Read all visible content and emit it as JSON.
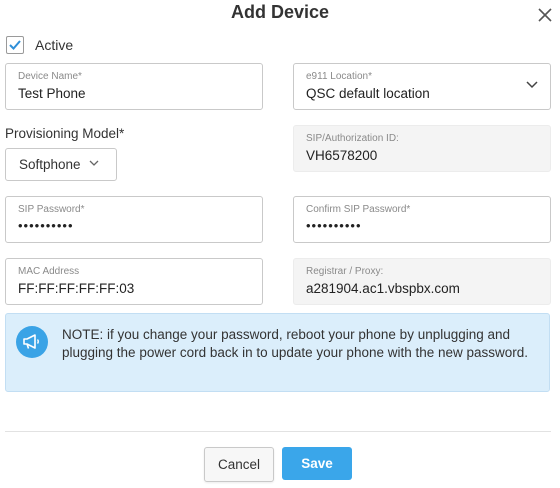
{
  "dialog": {
    "title": "Add Device",
    "active": {
      "label": "Active",
      "checked": true
    },
    "fields": {
      "device_name": {
        "label": "Device Name*",
        "value": "Test Phone"
      },
      "e911_location": {
        "label": "e911 Location*",
        "value": "QSC default location"
      },
      "provisioning_model": {
        "label": "Provisioning Model*",
        "value": "Softphone"
      },
      "sip_auth_id": {
        "label": "SIP/Authorization ID:",
        "value": "VH6578200"
      },
      "sip_password": {
        "label": "SIP Password*",
        "value": "••••••••••"
      },
      "confirm_sip_password": {
        "label": "Confirm SIP Password*",
        "value": "••••••••••"
      },
      "mac_address": {
        "label": "MAC Address",
        "value": "FF:FF:FF:FF:FF:03"
      },
      "registrar_proxy": {
        "label": "Registrar / Proxy:",
        "value": "a281904.ac1.vbspbx.com"
      }
    },
    "note": "NOTE: if you change your password, reboot your phone by unplugging and plugging the power cord back in to update your phone with the new password.",
    "buttons": {
      "cancel": "Cancel",
      "save": "Save"
    }
  },
  "icons": [
    "close-icon",
    "checkmark-icon",
    "chevron-down-icon",
    "megaphone-icon"
  ],
  "colors": {
    "accent": "#3aa6ea",
    "note_bg": "#dbeefb",
    "readonly_bg": "#f4f4f4"
  }
}
